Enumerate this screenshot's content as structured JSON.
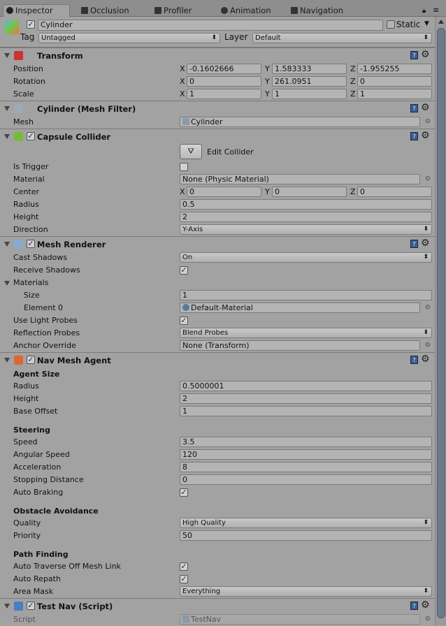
{
  "tabs": [
    {
      "label": "Inspector",
      "icon": "info-icon",
      "active": true
    },
    {
      "label": "Occlusion",
      "icon": "occlusion-icon"
    },
    {
      "label": "Profiler",
      "icon": "profiler-icon"
    },
    {
      "label": "Animation",
      "icon": "clock-icon"
    },
    {
      "label": "Navigation",
      "icon": "navigation-icon"
    }
  ],
  "gameobject": {
    "active": true,
    "name": "Cylinder",
    "static_label": "Static",
    "static": false,
    "tag_label": "Tag",
    "tag": "Untagged",
    "layer_label": "Layer",
    "layer": "Default"
  },
  "components": [
    {
      "title": "Transform",
      "icon": "transform-icon",
      "checkbox": null,
      "rows": [
        {
          "type": "vec3",
          "label": "Position",
          "values": [
            "-0.1602666",
            "1.583333",
            "-1.955255"
          ]
        },
        {
          "type": "vec3",
          "label": "Rotation",
          "values": [
            "0",
            "261.0951",
            "0"
          ]
        },
        {
          "type": "vec3",
          "label": "Scale",
          "values": [
            "1",
            "1",
            "1"
          ]
        }
      ]
    },
    {
      "title": "Cylinder (Mesh Filter)",
      "icon": "mesh-filter-icon",
      "checkbox": null,
      "rows": [
        {
          "type": "object",
          "label": "Mesh",
          "value": "Cylinder",
          "icon": "mesh-icon"
        }
      ]
    },
    {
      "title": "Capsule Collider",
      "icon": "capsule-collider-icon",
      "checkbox": true,
      "rows": [
        {
          "type": "button",
          "label": "Edit Collider"
        },
        {
          "type": "check",
          "label": "Is Trigger",
          "value": false
        },
        {
          "type": "object",
          "label": "Material",
          "value": "None (Physic Material)"
        },
        {
          "type": "vec3",
          "label": "Center",
          "values": [
            "0",
            "0",
            "0"
          ]
        },
        {
          "type": "text",
          "label": "Radius",
          "value": "0.5"
        },
        {
          "type": "text",
          "label": "Height",
          "value": "2"
        },
        {
          "type": "dropdown",
          "label": "Direction",
          "value": "Y-Axis"
        }
      ]
    },
    {
      "title": "Mesh Renderer",
      "icon": "mesh-renderer-icon",
      "checkbox": true,
      "rows": [
        {
          "type": "dropdown",
          "label": "Cast Shadows",
          "value": "On"
        },
        {
          "type": "check",
          "label": "Receive Shadows",
          "value": true
        },
        {
          "type": "foldout",
          "label": "Materials"
        },
        {
          "type": "text",
          "label": "Size",
          "value": "1",
          "indent": true
        },
        {
          "type": "object",
          "label": "Element 0",
          "value": "Default-Material",
          "icon": "material-icon",
          "indent": true
        },
        {
          "type": "check",
          "label": "Use Light Probes",
          "value": true
        },
        {
          "type": "dropdown",
          "label": "Reflection Probes",
          "value": "Blend Probes"
        },
        {
          "type": "object",
          "label": "Anchor Override",
          "value": "None (Transform)"
        }
      ]
    },
    {
      "title": "Nav Mesh Agent",
      "icon": "nav-mesh-agent-icon",
      "checkbox": true,
      "rows": [
        {
          "type": "section",
          "label": "Agent Size"
        },
        {
          "type": "text",
          "label": "Radius",
          "value": "0.5000001"
        },
        {
          "type": "text",
          "label": "Height",
          "value": "2"
        },
        {
          "type": "text",
          "label": "Base Offset",
          "value": "1"
        },
        {
          "type": "spacer"
        },
        {
          "type": "section",
          "label": "Steering"
        },
        {
          "type": "text",
          "label": "Speed",
          "value": "3.5"
        },
        {
          "type": "text",
          "label": "Angular Speed",
          "value": "120"
        },
        {
          "type": "text",
          "label": "Acceleration",
          "value": "8"
        },
        {
          "type": "text",
          "label": "Stopping Distance",
          "value": "0"
        },
        {
          "type": "check",
          "label": "Auto Braking",
          "value": true
        },
        {
          "type": "spacer"
        },
        {
          "type": "section",
          "label": "Obstacle Avoidance"
        },
        {
          "type": "dropdown",
          "label": "Quality",
          "value": "High Quality"
        },
        {
          "type": "text",
          "label": "Priority",
          "value": "50"
        },
        {
          "type": "spacer"
        },
        {
          "type": "section",
          "label": "Path Finding"
        },
        {
          "type": "check",
          "label": "Auto Traverse Off Mesh Link",
          "value": true
        },
        {
          "type": "check",
          "label": "Auto Repath",
          "value": true
        },
        {
          "type": "dropdown",
          "label": "Area Mask",
          "value": "Everything"
        }
      ]
    },
    {
      "title": "Test Nav (Script)",
      "icon": "script-icon",
      "checkbox": true,
      "rows": [
        {
          "type": "object",
          "label": "Script",
          "value": "TestNav",
          "icon": "script-icon",
          "disabled": true
        }
      ]
    }
  ],
  "colors": {
    "background": "#a2a2a2",
    "field": "#b4b4b4",
    "scrollbar_thumb": "#6d7a8c"
  }
}
